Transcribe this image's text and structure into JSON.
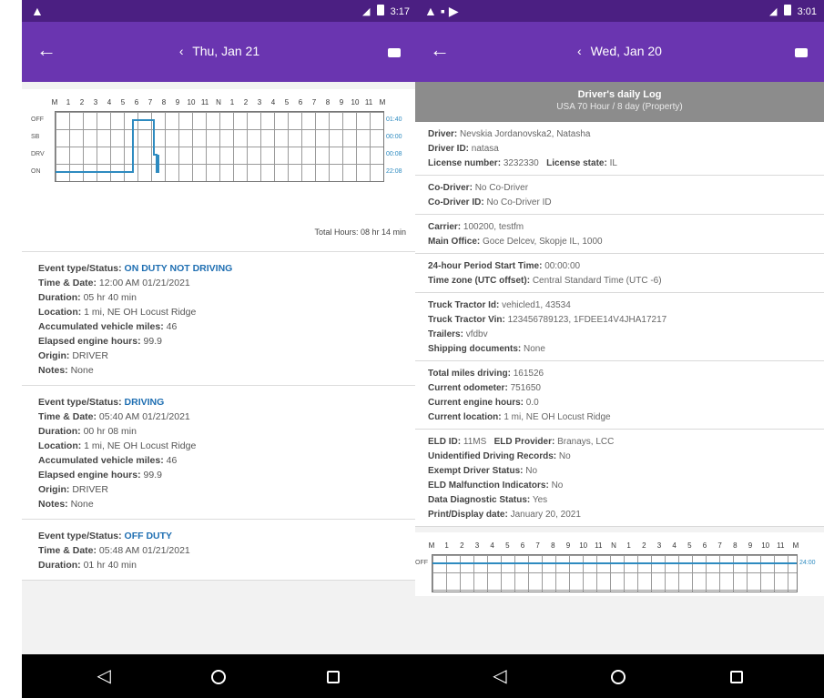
{
  "left": {
    "status_time": "3:17",
    "app_title": "Thu, Jan 21",
    "chart": {
      "hours": [
        "M",
        "1",
        "2",
        "3",
        "4",
        "5",
        "6",
        "7",
        "8",
        "9",
        "10",
        "11",
        "N",
        "1",
        "2",
        "3",
        "4",
        "5",
        "6",
        "7",
        "8",
        "9",
        "10",
        "11",
        "M"
      ],
      "statuses": [
        "OFF",
        "SB",
        "DRV",
        "ON"
      ],
      "totals": [
        "01:40",
        "00:00",
        "00:08",
        "22:08"
      ],
      "total_hours": "Total Hours: 08 hr 14 min"
    },
    "events": [
      {
        "status_label": "Event type/Status:",
        "status_value": "ON DUTY NOT DRIVING",
        "time_label": "Time & Date:",
        "time_value": "12:00 AM 01/21/2021",
        "duration_label": "Duration:",
        "duration_value": "05 hr 40 min",
        "location_label": "Location:",
        "location_value": "1 mi, NE OH Locust Ridge",
        "miles_label": "Accumulated vehicle miles:",
        "miles_value": "46",
        "engine_label": "Elapsed engine hours:",
        "engine_value": "99.9",
        "origin_label": "Origin:",
        "origin_value": "DRIVER",
        "notes_label": "Notes:",
        "notes_value": "None"
      },
      {
        "status_label": "Event type/Status:",
        "status_value": "DRIVING",
        "time_label": "Time & Date:",
        "time_value": "05:40 AM 01/21/2021",
        "duration_label": "Duration:",
        "duration_value": "00 hr 08 min",
        "location_label": "Location:",
        "location_value": "1 mi, NE OH Locust Ridge",
        "miles_label": "Accumulated vehicle miles:",
        "miles_value": "46",
        "engine_label": "Elapsed engine hours:",
        "engine_value": "99.9",
        "origin_label": "Origin:",
        "origin_value": "DRIVER",
        "notes_label": "Notes:",
        "notes_value": "None"
      },
      {
        "status_label": "Event type/Status:",
        "status_value": "OFF DUTY",
        "time_label": "Time & Date:",
        "time_value": "05:48 AM 01/21/2021",
        "duration_label": "Duration:",
        "duration_value": "01 hr 40 min"
      }
    ]
  },
  "right": {
    "status_time": "3:01",
    "app_title": "Wed, Jan 20",
    "log_title": "Driver's daily Log",
    "log_subtitle": "USA 70 Hour / 8 day (Property)",
    "blocks": [
      [
        {
          "label": "Driver:",
          "value": "Nevskia Jordanovska2, Natasha"
        },
        {
          "label": "Driver ID:",
          "value": "natasa"
        },
        {
          "label": "License number:",
          "value": "3232330",
          "label2": "License state:",
          "value2": "IL"
        }
      ],
      [
        {
          "label": "Co-Driver:",
          "value": "No Co-Driver"
        },
        {
          "label": "Co-Driver ID:",
          "value": "No Co-Driver ID"
        }
      ],
      [
        {
          "label": "Carrier:",
          "value": "100200, testfm"
        },
        {
          "label": "Main Office:",
          "value": "Goce Delcev, Skopje IL, 1000"
        }
      ],
      [
        {
          "label": "24-hour Period Start Time:",
          "value": "00:00:00"
        },
        {
          "label": "Time zone (UTC offset):",
          "value": "Central Standard Time (UTC -6)"
        }
      ],
      [
        {
          "label": "Truck Tractor Id:",
          "value": "vehicled1, 43534"
        },
        {
          "label": "Truck Tractor Vin:",
          "value": "123456789123, 1FDEE14V4JHA17217"
        },
        {
          "label": "Trailers:",
          "value": "vfdbv"
        },
        {
          "label": "Shipping documents:",
          "value": "None"
        }
      ],
      [
        {
          "label": "Total miles driving:",
          "value": "161526"
        },
        {
          "label": "Current odometer:",
          "value": "751650"
        },
        {
          "label": "Current engine hours:",
          "value": "0.0"
        },
        {
          "label": "Current location:",
          "value": "1 mi, NE OH Locust Ridge"
        }
      ],
      [
        {
          "label": "ELD ID:",
          "value": "11MS",
          "label2": "ELD Provider:",
          "value2": "Branays, LCC"
        },
        {
          "label": "Unidentified Driving Records:",
          "value": "No"
        },
        {
          "label": "Exempt Driver Status:",
          "value": "No"
        },
        {
          "label": "ELD Malfunction Indicators:",
          "value": "No"
        },
        {
          "label": "Data Diagnostic Status:",
          "value": "Yes"
        },
        {
          "label": "Print/Display date:",
          "value": "January 20, 2021"
        }
      ]
    ],
    "chart": {
      "hours": [
        "M",
        "1",
        "2",
        "3",
        "4",
        "5",
        "6",
        "7",
        "8",
        "9",
        "10",
        "11",
        "N",
        "1",
        "2",
        "3",
        "4",
        "5",
        "6",
        "7",
        "8",
        "9",
        "10",
        "11",
        "M"
      ],
      "statuses": [
        "OFF"
      ],
      "totals": [
        "24:00"
      ]
    }
  }
}
